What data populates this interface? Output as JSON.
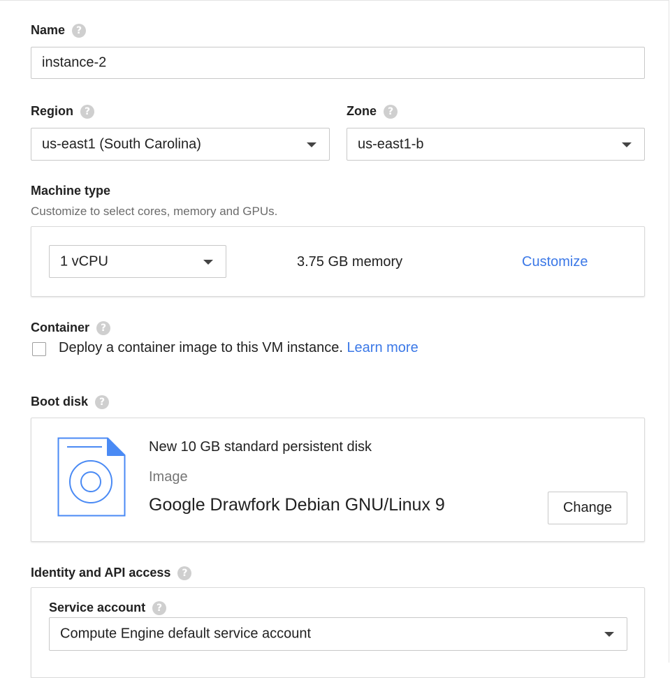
{
  "name_section": {
    "label": "Name",
    "value": "instance-2"
  },
  "region_section": {
    "label": "Region",
    "value": "us-east1 (South Carolina)"
  },
  "zone_section": {
    "label": "Zone",
    "value": "us-east1-b"
  },
  "machine_type": {
    "label": "Machine type",
    "description": "Customize to select cores, memory and GPUs.",
    "cpu_value": "1 vCPU",
    "memory": "3.75 GB memory",
    "customize_link": "Customize"
  },
  "container": {
    "label": "Container",
    "checkbox_text": "Deploy a container image to this VM instance.",
    "learn_more": "Learn more",
    "checked": false
  },
  "boot_disk": {
    "label": "Boot disk",
    "disk_description": "New 10 GB standard persistent disk",
    "image_label": "Image",
    "image_name": "Google Drawfork Debian GNU/Linux 9",
    "change_button": "Change"
  },
  "identity": {
    "label": "Identity and API access",
    "service_account_label": "Service account",
    "service_account_value": "Compute Engine default service account"
  },
  "colors": {
    "link": "#3b78e7",
    "disk_icon": "#4a8af4",
    "help_icon": "#cfcfcf"
  },
  "icons": [
    "help-icon",
    "dropdown-caret-icon",
    "disk-icon",
    "checkbox-icon"
  ]
}
